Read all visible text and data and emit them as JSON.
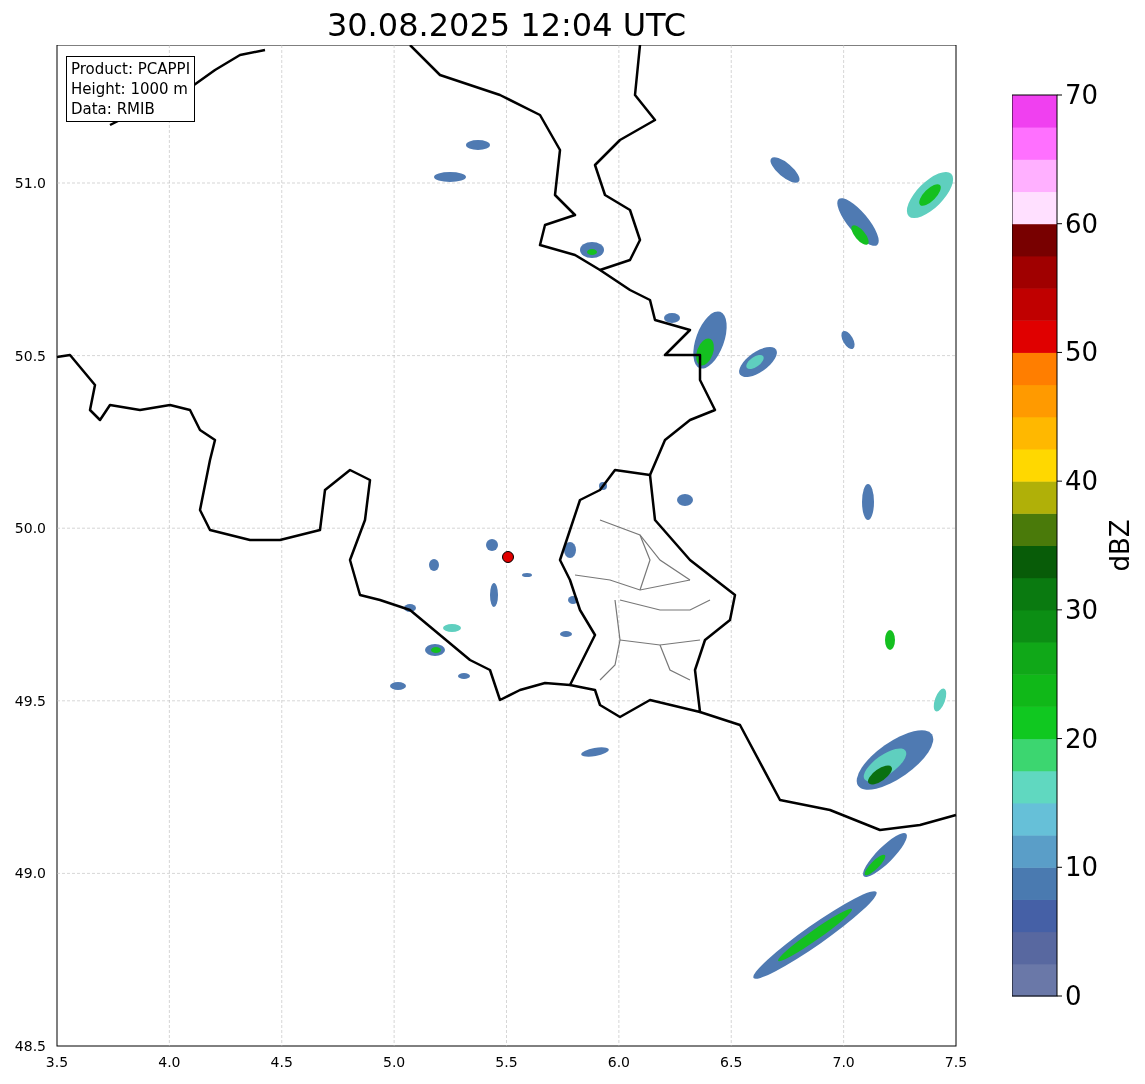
{
  "title": "30.08.2025 12:04 UTC",
  "info_box": [
    "Product: PCAPPI",
    "Height: 1000 m",
    "Data: RMIB"
  ],
  "map": {
    "x_ticks": [
      "3.5",
      "4.0",
      "4.5",
      "5.0",
      "5.5",
      "6.0",
      "6.5",
      "7.0",
      "7.5"
    ],
    "y_ticks": [
      "51.0",
      "50.5",
      "50.0",
      "49.5",
      "49.0",
      "48.5"
    ]
  },
  "colorbar": {
    "label": "dBZ",
    "ticks": [
      "70",
      "60",
      "50",
      "40",
      "30",
      "20",
      "10",
      "0"
    ]
  }
}
